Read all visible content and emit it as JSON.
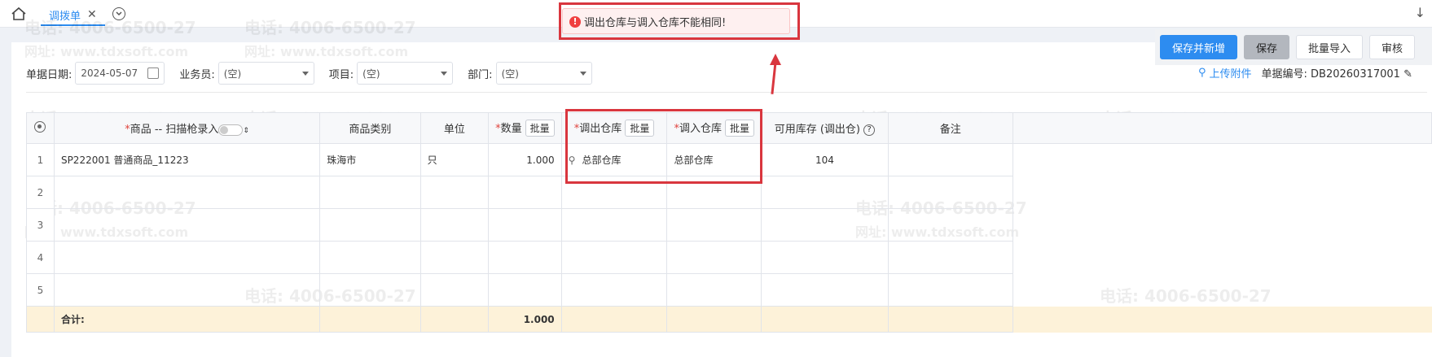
{
  "tabs": [
    {
      "label": "调拨单"
    }
  ],
  "toast": {
    "message": "调出仓库与调入仓库不能相同!"
  },
  "actions": {
    "save_new": "保存并新增",
    "save": "保存",
    "batch_import": "批量导入",
    "audit": "审核"
  },
  "form": {
    "date_label": "单据日期:",
    "date_value": "2024-05-07",
    "staff_label": "业务员:",
    "staff_value": "(空)",
    "project_label": "项目:",
    "project_value": "(空)",
    "dept_label": "部门:",
    "dept_value": "(空)"
  },
  "meta": {
    "upload": "上传附件",
    "docno_label": "单据编号:",
    "docno_value": "DB20260317001"
  },
  "grid": {
    "headers": {
      "product": "商品 -- 扫描枪录入",
      "category": "商品类别",
      "unit": "单位",
      "qty": "数量",
      "out_wh": "调出仓库",
      "in_wh": "调入仓库",
      "stock": "可用库存 (调出仓)",
      "remark": "备注",
      "batch": "批量"
    },
    "rows": [
      {
        "idx": "1",
        "product": "SP222001 普通商品_11223",
        "category": "珠海市",
        "unit": "只",
        "qty": "1.000",
        "out_wh": "总部仓库",
        "in_wh": "总部仓库",
        "stock": "104",
        "remark": ""
      },
      {
        "idx": "2",
        "product": "",
        "category": "",
        "unit": "",
        "qty": "",
        "out_wh": "",
        "in_wh": "",
        "stock": "",
        "remark": ""
      },
      {
        "idx": "3",
        "product": "",
        "category": "",
        "unit": "",
        "qty": "",
        "out_wh": "",
        "in_wh": "",
        "stock": "",
        "remark": ""
      },
      {
        "idx": "4",
        "product": "",
        "category": "",
        "unit": "",
        "qty": "",
        "out_wh": "",
        "in_wh": "",
        "stock": "",
        "remark": ""
      },
      {
        "idx": "5",
        "product": "",
        "category": "",
        "unit": "",
        "qty": "",
        "out_wh": "",
        "in_wh": "",
        "stock": "",
        "remark": ""
      }
    ],
    "total_label": "合计:",
    "total_qty": "1.000"
  },
  "watermark": {
    "phone": "电话: 4006-6500-27",
    "site": "网址: www.tdxsoft.com"
  },
  "colors": {
    "primary": "#2d8cf0",
    "error": "#f04040",
    "annotation": "#d9363e",
    "total_row": "#fdf2d9"
  }
}
